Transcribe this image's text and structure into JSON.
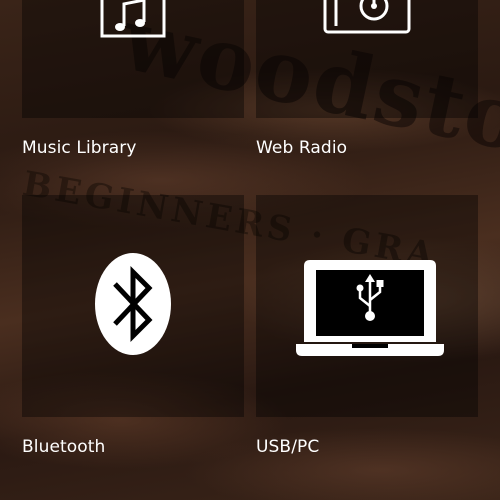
{
  "tiles": [
    {
      "label": "Music Library",
      "icon": "music-note-icon"
    },
    {
      "label": "Web Radio",
      "icon": "radio-icon"
    },
    {
      "label": "Bluetooth",
      "icon": "bluetooth-icon"
    },
    {
      "label": "USB/PC",
      "icon": "laptop-usb-icon"
    }
  ],
  "colors": {
    "text": "#ffffff",
    "tile_overlay": "rgba(0,0,0,0.38)"
  }
}
